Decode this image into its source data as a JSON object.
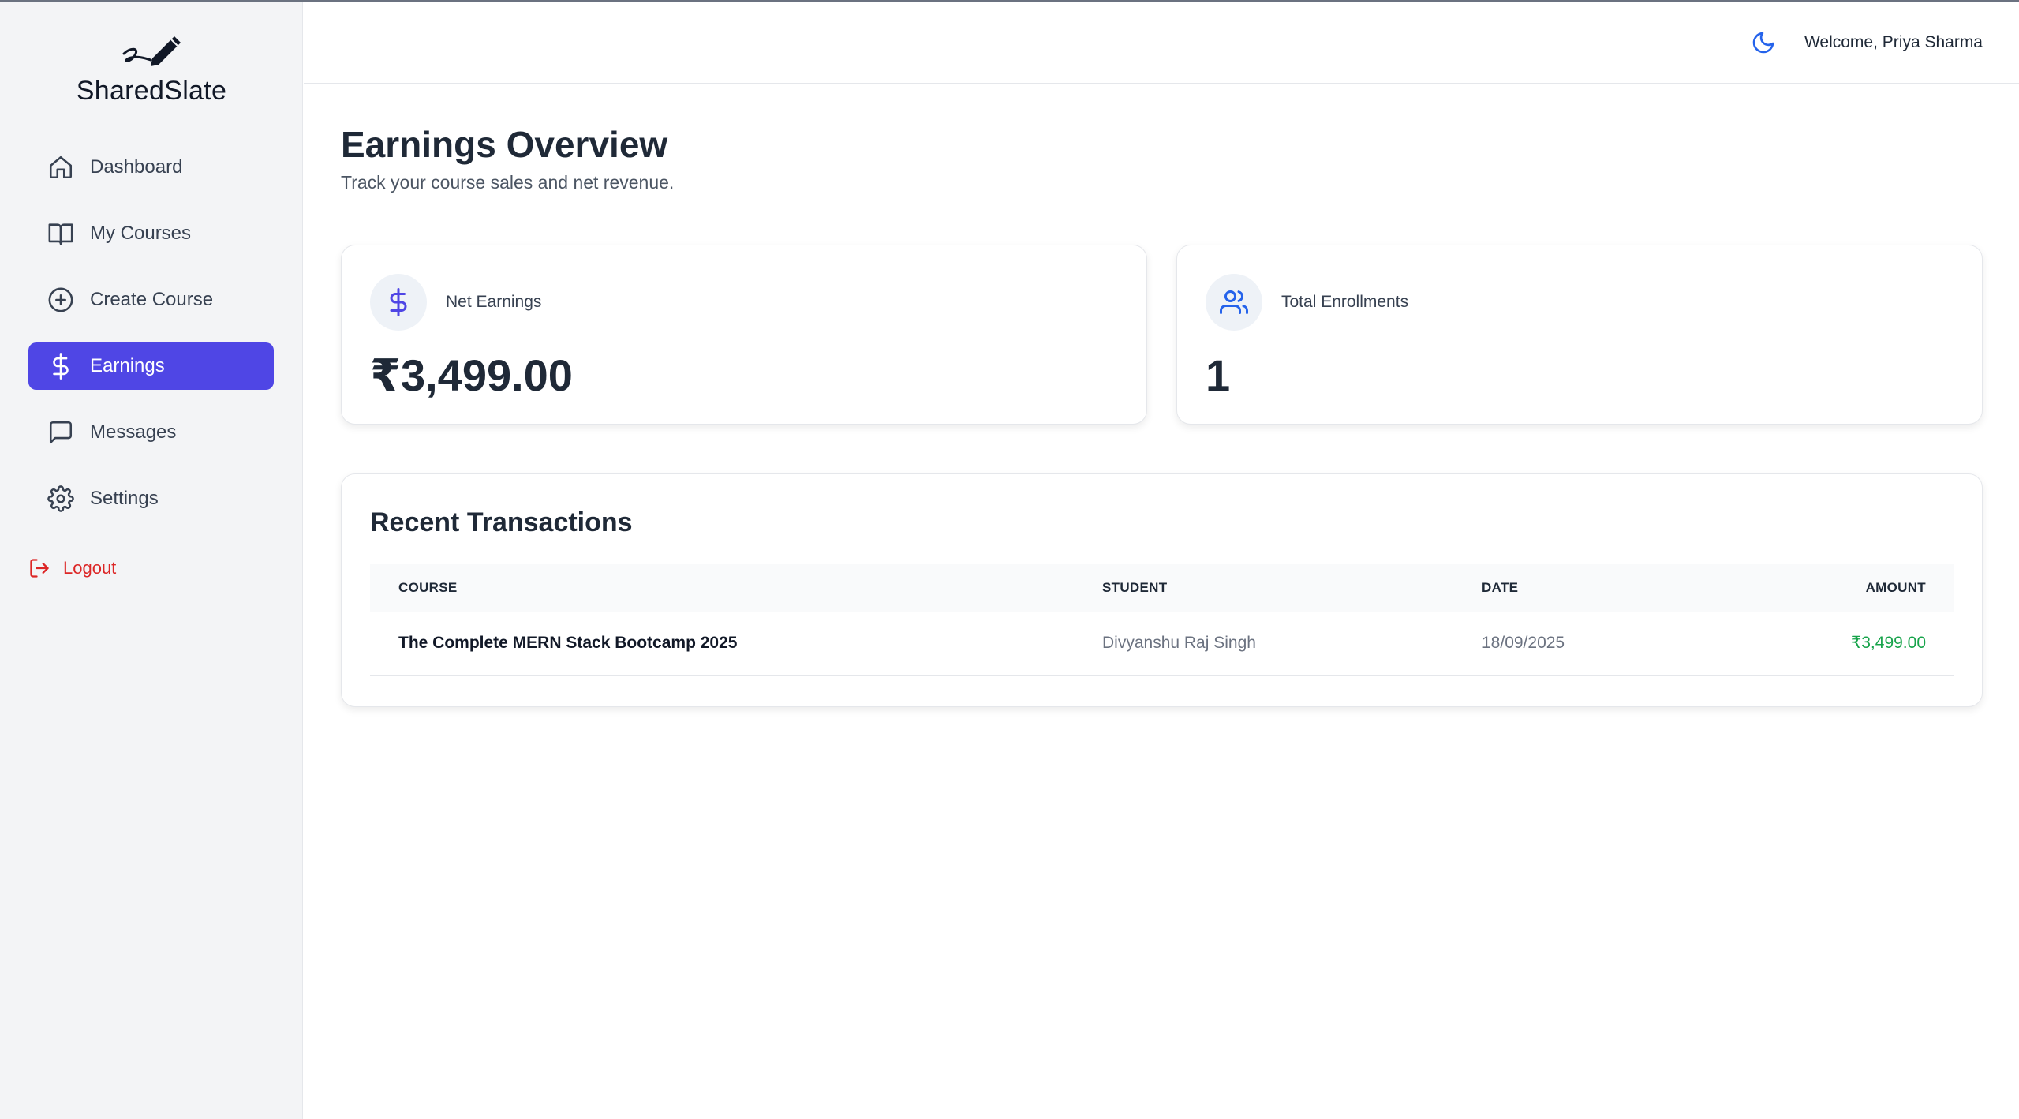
{
  "app": {
    "brand": "SharedSlate"
  },
  "header": {
    "welcome": "Welcome, Priya Sharma",
    "theme_icon": "moon-icon"
  },
  "sidebar": {
    "items": [
      {
        "label": "Dashboard",
        "icon": "home-icon",
        "active": false
      },
      {
        "label": "My Courses",
        "icon": "book-icon",
        "active": false
      },
      {
        "label": "Create Course",
        "icon": "plus-circle-icon",
        "active": false
      },
      {
        "label": "Earnings",
        "icon": "dollar-icon",
        "active": true
      },
      {
        "label": "Messages",
        "icon": "message-square-icon",
        "active": false
      },
      {
        "label": "Settings",
        "icon": "gear-icon",
        "active": false
      }
    ],
    "logout": "Logout"
  },
  "page": {
    "title": "Earnings Overview",
    "subtitle": "Track your course sales and net revenue."
  },
  "stats": [
    {
      "label": "Net Earnings",
      "value": "₹3,499.00",
      "icon": "dollar-icon",
      "icon_color": "#4f46e5"
    },
    {
      "label": "Total Enrollments",
      "value": "1",
      "icon": "users-icon",
      "icon_color": "#2563eb"
    }
  ],
  "transactions": {
    "title": "Recent Transactions",
    "columns": [
      "COURSE",
      "STUDENT",
      "DATE",
      "AMOUNT"
    ],
    "rows": [
      {
        "course": "The Complete MERN Stack Bootcamp 2025",
        "student": "Divyanshu Raj Singh",
        "date": "18/09/2025",
        "amount": "₹3,499.00"
      }
    ]
  },
  "colors": {
    "accent": "#4f46e5",
    "danger": "#dc2626",
    "success": "#16a34a",
    "sidebar_bg": "#f3f4f6"
  }
}
